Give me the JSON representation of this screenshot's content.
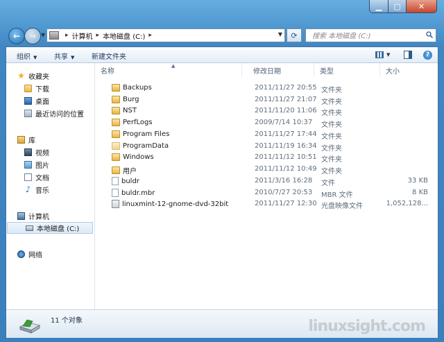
{
  "nav": {
    "breadcrumb": [
      "计算机",
      "本地磁盘 (C:)"
    ],
    "search_placeholder": "搜索 本地磁盘 (C:)"
  },
  "toolbar": {
    "organize": "组织",
    "share": "共享",
    "new_folder": "新建文件夹"
  },
  "sidebar": {
    "favorites": "收藏夹",
    "downloads": "下载",
    "desktop": "桌面",
    "recent": "最近访问的位置",
    "libraries": "库",
    "videos": "视频",
    "pictures": "图片",
    "documents": "文档",
    "music": "音乐",
    "computer": "计算机",
    "local_disk": "本地磁盘 (C:)",
    "network": "网络"
  },
  "columns": {
    "name": "名称",
    "date": "修改日期",
    "type": "类型",
    "size": "大小"
  },
  "files": [
    {
      "name": "Backups",
      "date": "2011/11/27 20:55",
      "type": "文件夹",
      "size": "",
      "icon": "folder-icon"
    },
    {
      "name": "Burg",
      "date": "2011/11/27 21:07",
      "type": "文件夹",
      "size": "",
      "icon": "folder-icon"
    },
    {
      "name": "NST",
      "date": "2011/11/20 11:06",
      "type": "文件夹",
      "size": "",
      "icon": "folder-icon"
    },
    {
      "name": "PerfLogs",
      "date": "2009/7/14 10:37",
      "type": "文件夹",
      "size": "",
      "icon": "folder-icon"
    },
    {
      "name": "Program Files",
      "date": "2011/11/27 17:44",
      "type": "文件夹",
      "size": "",
      "icon": "folder-icon"
    },
    {
      "name": "ProgramData",
      "date": "2011/11/19 16:34",
      "type": "文件夹",
      "size": "",
      "icon": "folder-icon"
    },
    {
      "name": "Windows",
      "date": "2011/11/12 10:51",
      "type": "文件夹",
      "size": "",
      "icon": "folder-icon"
    },
    {
      "name": "用户",
      "date": "2011/11/12 10:49",
      "type": "文件夹",
      "size": "",
      "icon": "folder-icon"
    },
    {
      "name": "buldr",
      "date": "2011/3/16 16:28",
      "type": "文件",
      "size": "33 KB",
      "icon": "file-icon"
    },
    {
      "name": "buldr.mbr",
      "date": "2010/7/27 20:53",
      "type": "MBR 文件",
      "size": "8 KB",
      "icon": "file-icon"
    },
    {
      "name": "linuxmint-12-gnome-dvd-32bit",
      "date": "2011/11/27 12:30",
      "type": "光盘映像文件",
      "size": "1,052,128...",
      "icon": "disc-image-icon"
    }
  ],
  "status": {
    "count": "11 个对象"
  },
  "watermark": "linuxsight.com"
}
